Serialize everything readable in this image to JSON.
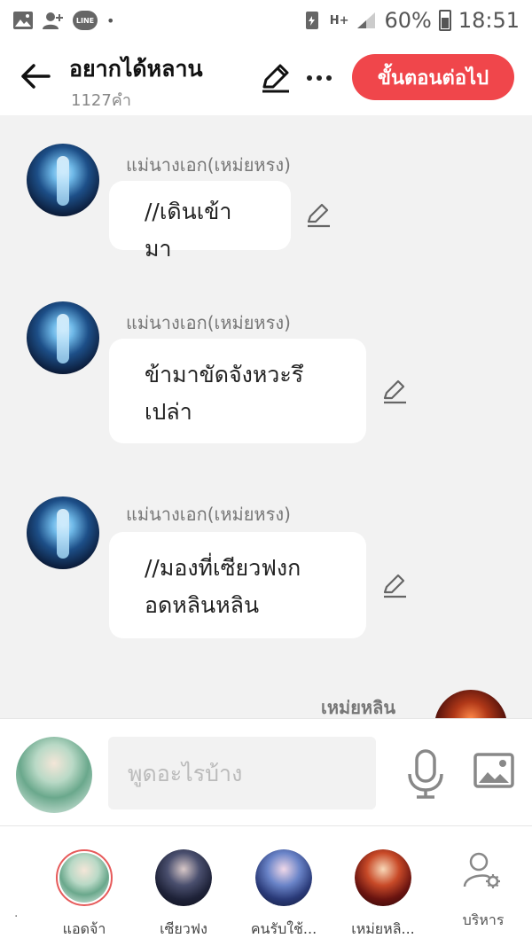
{
  "status_bar": {
    "line_label": "LINE",
    "network": "H+",
    "battery": "60%",
    "time": "18:51"
  },
  "header": {
    "title": "อยากได้หลาน",
    "word_count": "1127คำ",
    "next_button": "ขั้นตอนต่อไป"
  },
  "messages": [
    {
      "sender": "แม่นางเอก(เหม่ยหรง)",
      "lines": [
        "//เดินเข้ามา"
      ]
    },
    {
      "sender": "แม่นางเอก(เหม่ยหรง)",
      "lines": [
        "ข้ามาขัดจังหวะรึ",
        "เปล่า"
      ]
    },
    {
      "sender": "แม่นางเอก(เหม่ยหรง)",
      "lines": [
        "//มองที่เซียวฟงก",
        "อดหลินหลิน"
      ]
    }
  ],
  "partial_message": {
    "sender": "เหม่ยหลิน"
  },
  "input": {
    "placeholder": "พูดอะไรบ้าง",
    "value": ""
  },
  "characters": [
    {
      "label": "แอดจ้า",
      "selected": true,
      "color": "#9ed3b8"
    },
    {
      "label": "เซียวฟง",
      "selected": false,
      "color": "#2b2f4a"
    },
    {
      "label": "คนรับใช้...",
      "selected": false,
      "color": "#3a4e8a"
    },
    {
      "label": "เหม่ยหลิ...",
      "selected": false,
      "color": "#8a2418"
    }
  ],
  "manage_label": "บริหาร",
  "colors": {
    "accent": "#f0464b",
    "bubble": "#ffffff",
    "chat_bg": "#f2f2f2"
  }
}
